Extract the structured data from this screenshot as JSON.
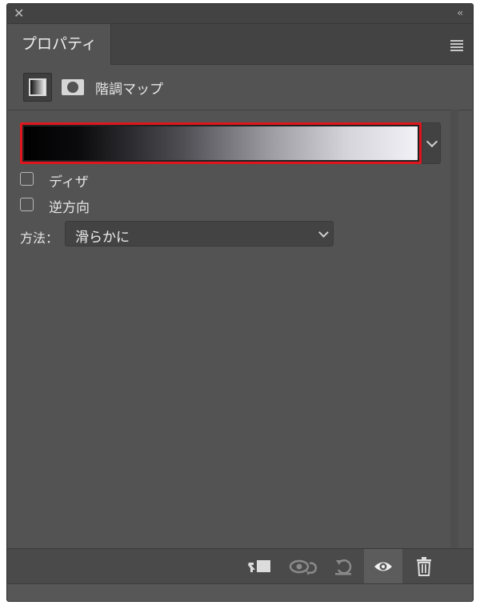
{
  "window": {
    "close_glyph": "✕",
    "collapse_glyph": "‹‹"
  },
  "tab": {
    "label": "プロパティ"
  },
  "header": {
    "title": "階調マップ",
    "adjustment_icon": "gradient-map-adjustment-icon",
    "mask_icon": "layer-mask-icon"
  },
  "gradient": {
    "stops": [
      "#000000",
      "#ffffff"
    ],
    "highlight_color": "#e0151d"
  },
  "options": {
    "dither_label": "ディザ",
    "dither_checked": false,
    "reverse_label": "逆方向",
    "reverse_checked": false
  },
  "method": {
    "label": "方法：",
    "value": "滑らかに"
  },
  "bottom_bar": {
    "icons": [
      "clip-to-layer-icon",
      "view-previous-state-icon",
      "reset-icon",
      "visibility-eye-icon",
      "trash-icon"
    ]
  },
  "colors": {
    "panel_bg": "#535353",
    "chrome_bg": "#434343",
    "text": "#e6e6e6"
  }
}
